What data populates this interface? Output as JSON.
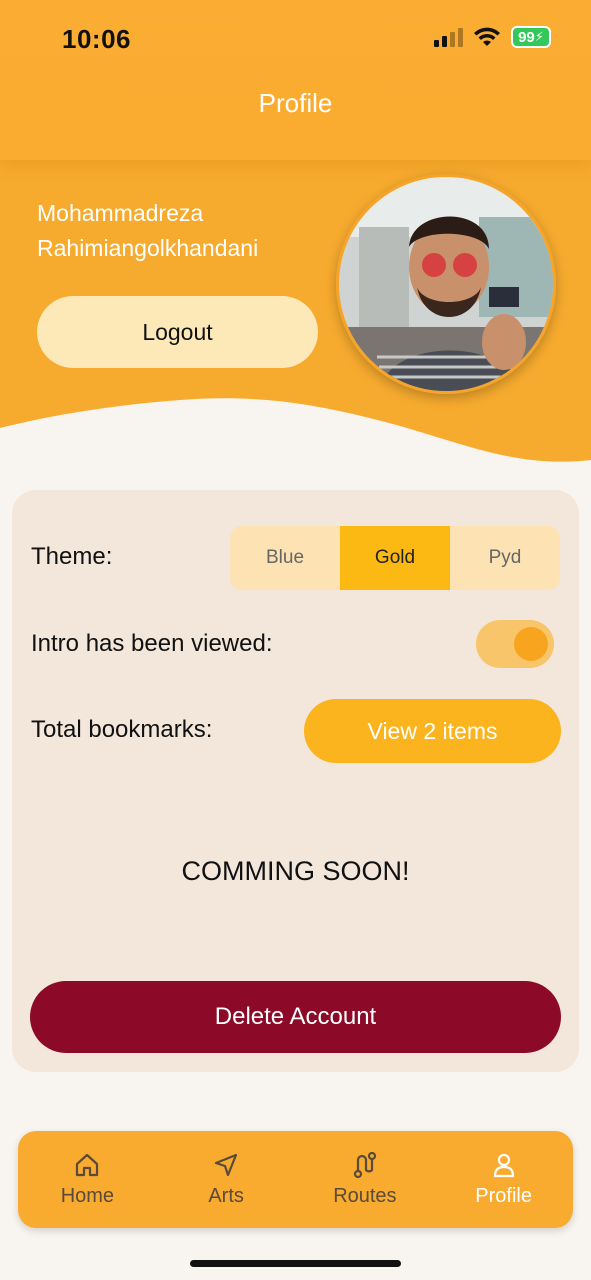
{
  "status_bar": {
    "time": "10:06",
    "battery": "99"
  },
  "header": {
    "title": "Profile"
  },
  "profile": {
    "name_line1": "Mohammadreza",
    "name_line2": "Rahimiangolkhandani",
    "logout_label": "Logout",
    "avatar_icon": "user-photo"
  },
  "settings": {
    "theme_label": "Theme:",
    "theme_options": [
      "Blue",
      "Gold",
      "Pyd"
    ],
    "theme_selected": "Gold",
    "intro_label": "Intro has been viewed:",
    "intro_viewed": true,
    "bookmarks_label": "Total bookmarks:",
    "bookmarks_button": "View 2 items",
    "coming_soon": "COMMING SOON!",
    "delete_label": "Delete Account"
  },
  "nav": {
    "items": [
      {
        "label": "Home",
        "icon": "home-icon"
      },
      {
        "label": "Arts",
        "icon": "navigation-arrow-icon"
      },
      {
        "label": "Routes",
        "icon": "route-icon"
      },
      {
        "label": "Profile",
        "icon": "user-icon"
      }
    ],
    "active": "Profile"
  },
  "colors": {
    "primary": "#fbb03b",
    "selected_theme": "#fdb913",
    "delete": "#8c0a27",
    "card": "#f3e6da"
  }
}
